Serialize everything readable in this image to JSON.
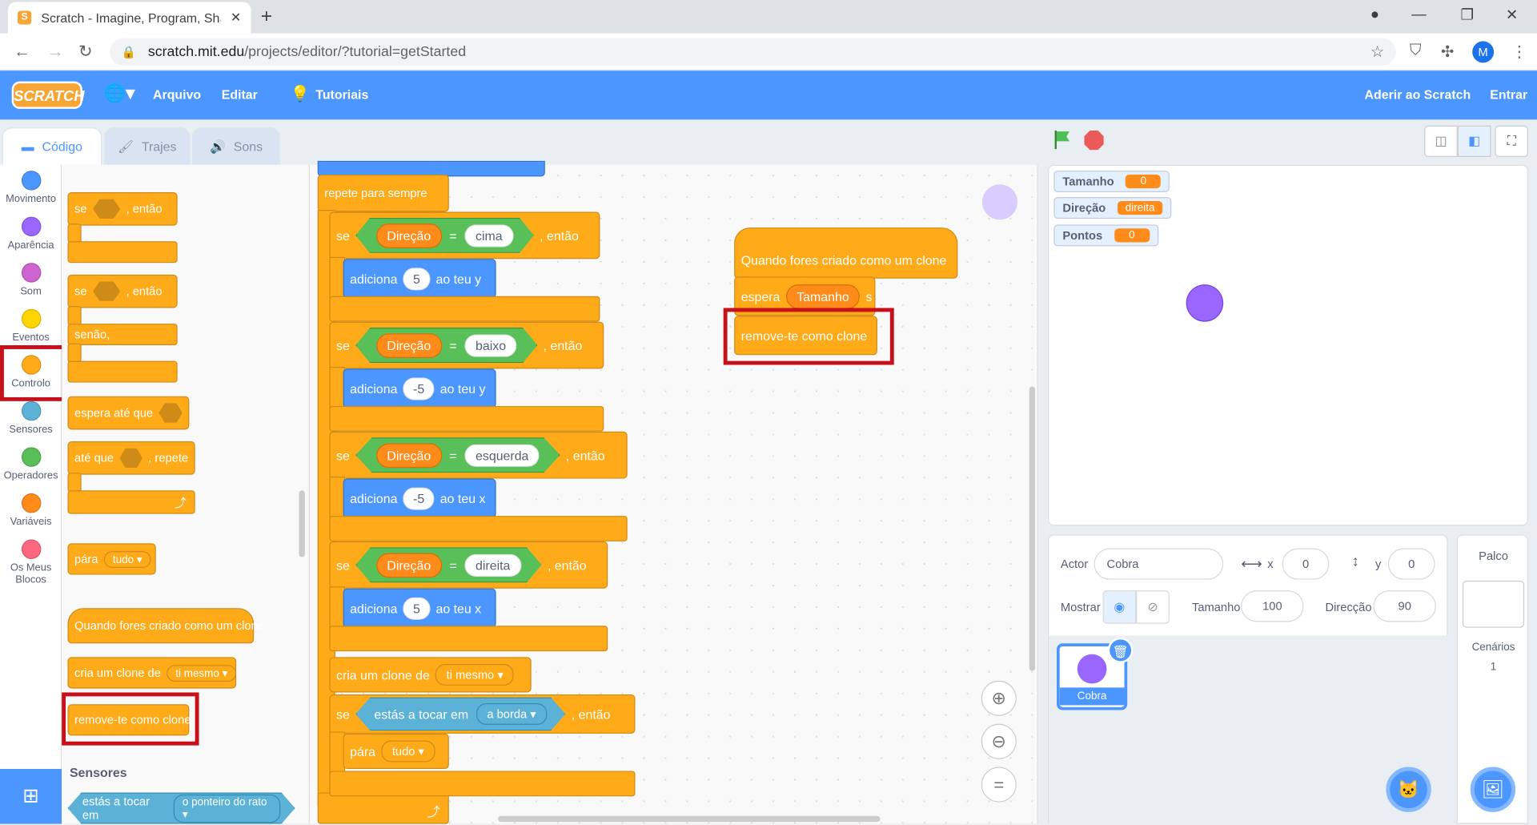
{
  "browser": {
    "tab_title": "Scratch - Imagine, Program, Shar",
    "url_host": "scratch.mit.edu",
    "url_path": "/projects/editor/?tutorial=getStarted",
    "account_initial": "M"
  },
  "menu": {
    "file": "Arquivo",
    "edit": "Editar",
    "tutorials": "Tutoriais",
    "join": "Aderir ao Scratch",
    "signin": "Entrar",
    "logo": "SCRATCH"
  },
  "tabs": {
    "code": "Código",
    "costumes": "Trajes",
    "sounds": "Sons"
  },
  "categories": [
    {
      "label": "Movimento",
      "color": "#4c97ff"
    },
    {
      "label": "Aparência",
      "color": "#9966ff"
    },
    {
      "label": "Som",
      "color": "#cf63cf"
    },
    {
      "label": "Eventos",
      "color": "#ffd500"
    },
    {
      "label": "Controlo",
      "color": "#ffab19"
    },
    {
      "label": "Sensores",
      "color": "#5cb1d6"
    },
    {
      "label": "Operadores",
      "color": "#59c059"
    },
    {
      "label": "Variáveis",
      "color": "#ff8c1a"
    },
    {
      "label": "Os Meus Blocos",
      "color": "#ff6680"
    }
  ],
  "palette": {
    "if_then_a": "se",
    "then_a": ", então",
    "if_then_b": "se",
    "then_b": ", então",
    "else": "senão,",
    "wait_until": "espera até que",
    "until": "até que",
    "repeat": ", repete",
    "stop": "pára",
    "stop_opt": "tudo",
    "when_clone": "Quando fores criado como um clone",
    "create_clone": "cria um clone de",
    "create_clone_opt": "ti mesmo",
    "delete_clone": "remove-te como clone",
    "sensing_header": "Sensores",
    "touching": "estás a tocar em",
    "touching_opt": "o ponteiro do rato"
  },
  "script": {
    "forever": "repete para sempre",
    "if": "se",
    "then": ", então",
    "dir_var": "Direção",
    "eq": "=",
    "cond": [
      {
        "val": "cima",
        "add": "adiciona",
        "num": "5",
        "axis": "ao teu y"
      },
      {
        "val": "baixo",
        "add": "adiciona",
        "num": "-5",
        "axis": "ao teu y"
      },
      {
        "val": "esquerda",
        "add": "adiciona",
        "num": "-5",
        "axis": "ao teu x"
      },
      {
        "val": "direita",
        "add": "adiciona",
        "num": "5",
        "axis": "ao teu x"
      }
    ],
    "create_clone": "cria um clone de",
    "create_clone_opt": "ti mesmo",
    "touching": "estás a tocar em",
    "touching_opt": "a borda",
    "stop": "pára",
    "stop_opt": "tudo",
    "hat_clone": "Quando fores criado como um clone",
    "wait": "espera",
    "wait_var": "Tamanho",
    "wait_unit": "s",
    "delete_clone": "remove-te como clone"
  },
  "monitors": [
    {
      "name": "Tamanho",
      "value": "0"
    },
    {
      "name": "Direção",
      "value": "direita"
    },
    {
      "name": "Pontos",
      "value": "0"
    }
  ],
  "sprite": {
    "actor_label": "Actor",
    "actor_name": "Cobra",
    "x_label": "x",
    "x": "0",
    "y_label": "y",
    "y": "0",
    "show_label": "Mostrar",
    "size_label": "Tamanho",
    "size": "100",
    "dir_label": "Direcção",
    "dir": "90",
    "thumb_name": "Cobra"
  },
  "stage_pane": {
    "title": "Palco",
    "backdrops_label": "Cenários",
    "backdrops_count": "1"
  }
}
